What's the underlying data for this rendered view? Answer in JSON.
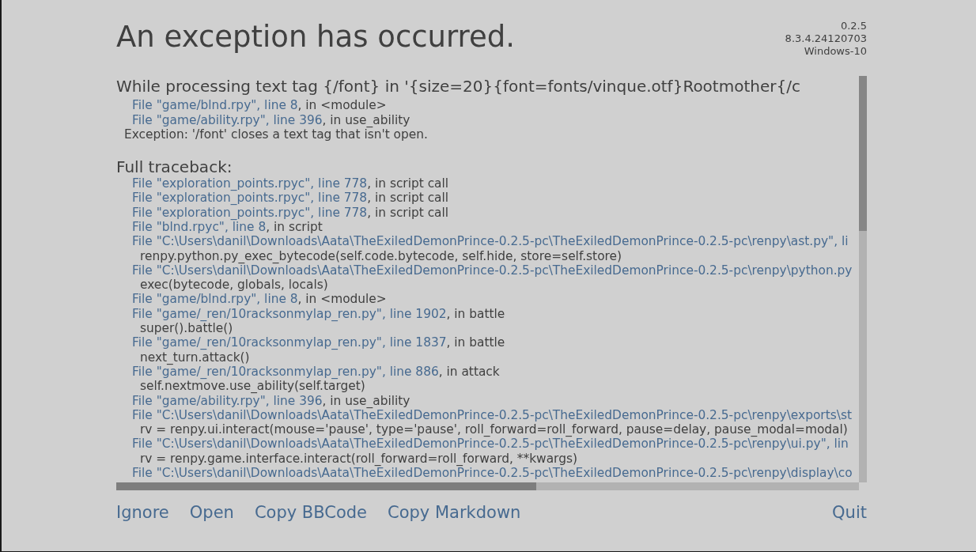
{
  "header": {
    "title": "An exception has occurred.",
    "version_info": [
      "0.2.5",
      "8.3.4.24120703",
      "Windows-10"
    ]
  },
  "error": {
    "message": "While processing text tag {/font} in '{size=20}{font=fonts/vinque.otf}Rootmother{/c",
    "frames": [
      {
        "location": "File \"game/blnd.rpy\", line 8",
        "context": ", in <module>"
      },
      {
        "location": "File \"game/ability.rpy\", line 396",
        "context": ", in use_ability"
      }
    ],
    "exception": "Exception: '/font' closes a text tag that isn't open."
  },
  "traceback": {
    "heading": "Full traceback:",
    "lines": [
      {
        "kind": "frame",
        "location": "File \"exploration_points.rpyc\", line 778",
        "context": ", in script call"
      },
      {
        "kind": "frame",
        "location": "File \"exploration_points.rpyc\", line 778",
        "context": ", in script call"
      },
      {
        "kind": "frame",
        "location": "File \"exploration_points.rpyc\", line 778",
        "context": ", in script call"
      },
      {
        "kind": "frame",
        "location": "File \"blnd.rpyc\", line 8",
        "context": ", in script"
      },
      {
        "kind": "frame",
        "location": "File \"C:\\Users\\danil\\Downloads\\Aata\\TheExiledDemonPrince-0.2.5-pc\\TheExiledDemonPrince-0.2.5-pc\\renpy\\ast.py\", li"
      },
      {
        "kind": "code",
        "text": "renpy.python.py_exec_bytecode(self.code.bytecode, self.hide, store=self.store)"
      },
      {
        "kind": "frame",
        "location": "File \"C:\\Users\\danil\\Downloads\\Aata\\TheExiledDemonPrince-0.2.5-pc\\TheExiledDemonPrince-0.2.5-pc\\renpy\\python.py"
      },
      {
        "kind": "code",
        "text": "exec(bytecode, globals, locals)"
      },
      {
        "kind": "frame",
        "location": "File \"game/blnd.rpy\", line 8",
        "context": ", in <module>"
      },
      {
        "kind": "frame",
        "location": "File \"game/_ren/10racksonmylap_ren.py\", line 1902",
        "context": ", in battle"
      },
      {
        "kind": "code",
        "text": "super().battle()"
      },
      {
        "kind": "frame",
        "location": "File \"game/_ren/10racksonmylap_ren.py\", line 1837",
        "context": ", in battle"
      },
      {
        "kind": "code",
        "text": "next_turn.attack()"
      },
      {
        "kind": "frame",
        "location": "File \"game/_ren/10racksonmylap_ren.py\", line 886",
        "context": ", in attack"
      },
      {
        "kind": "code",
        "text": "self.nextmove.use_ability(self.target)"
      },
      {
        "kind": "frame",
        "location": "File \"game/ability.rpy\", line 396",
        "context": ", in use_ability"
      },
      {
        "kind": "frame",
        "location": "File \"C:\\Users\\danil\\Downloads\\Aata\\TheExiledDemonPrince-0.2.5-pc\\TheExiledDemonPrince-0.2.5-pc\\renpy\\exports\\st"
      },
      {
        "kind": "code",
        "text": "rv = renpy.ui.interact(mouse='pause', type='pause', roll_forward=roll_forward, pause=delay, pause_modal=modal)"
      },
      {
        "kind": "frame",
        "location": "File \"C:\\Users\\danil\\Downloads\\Aata\\TheExiledDemonPrince-0.2.5-pc\\TheExiledDemonPrince-0.2.5-pc\\renpy\\ui.py\", lin"
      },
      {
        "kind": "code",
        "text": "rv = renpy.game.interface.interact(roll_forward=roll_forward, **kwargs)"
      },
      {
        "kind": "frame",
        "location": "File \"C:\\Users\\danil\\Downloads\\Aata\\TheExiledDemonPrince-0.2.5-pc\\TheExiledDemonPrince-0.2.5-pc\\renpy\\display\\co"
      }
    ]
  },
  "buttons": [
    "Ignore",
    "Open",
    "Copy BBCode",
    "Copy Markdown"
  ],
  "quit_button": "Quit"
}
